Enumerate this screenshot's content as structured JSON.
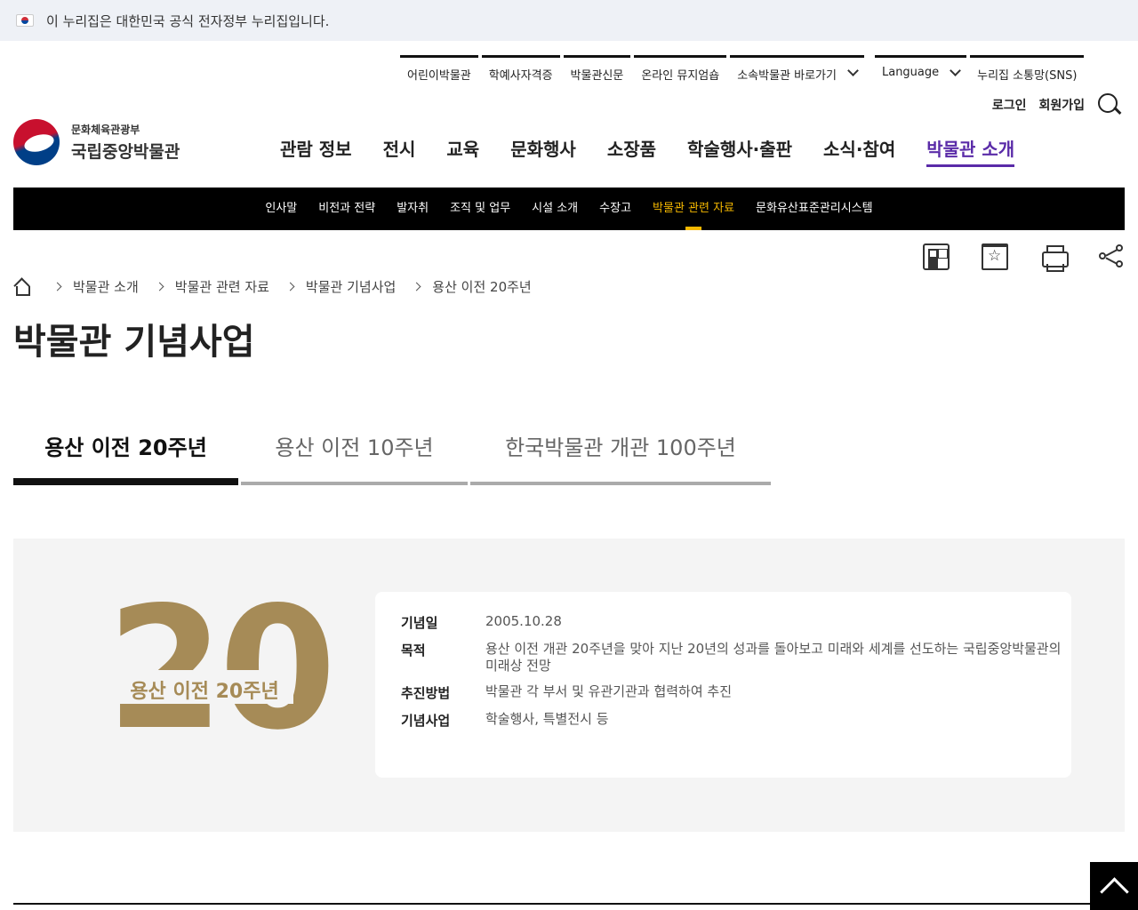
{
  "gov_banner": {
    "text": "이 누리집은 대한민국 공식 전자정부 누리집입니다."
  },
  "util_nav": [
    "어린이박물관",
    "학예사자격증",
    "박물관신문",
    "온라인 뮤지엄숍",
    "소속박물관 바로가기",
    "Language",
    "누리집 소통망(SNS)"
  ],
  "account": {
    "login": "로그인",
    "signup": "회원가입"
  },
  "logo": {
    "sub": "문화체육관광부",
    "main": "국립중앙박물관"
  },
  "main_nav": [
    "관람 정보",
    "전시",
    "교육",
    "문화행사",
    "소장품",
    "학술행사·출판",
    "소식·참여",
    "박물관 소개"
  ],
  "main_nav_active": 7,
  "sub_nav": [
    "인사말",
    "비전과 전략",
    "발자취",
    "조직 및 업무",
    "시설 소개",
    "수장고",
    "박물관 관련 자료",
    "문화유산표준관리시스템"
  ],
  "sub_nav_active": 6,
  "breadcrumb": [
    "박물관 소개",
    "박물관 관련 자료",
    "박물관 기념사업",
    "용산 이전 20주년"
  ],
  "page_title": "박물관 기념사업",
  "tabs": [
    "용산 이전 20주년",
    "용산 이전 10주년",
    "한국박물관 개관 100주년"
  ],
  "tabs_active": 0,
  "emblem": {
    "digits": "20",
    "label": "용산 이전 20주년"
  },
  "info_rows": [
    {
      "label": "기념일",
      "value": "2005.10.28"
    },
    {
      "label": "목적",
      "value": "용산 이전 개관 20주년을 맞아 지난 20년의 성과를 돌아보고 미래와 세계를 선도하는 국립중앙박물관의 미래상 전망"
    },
    {
      "label": "추진방법",
      "value": "박물관 각 부서 및 유관기관과 협력하여 추진"
    },
    {
      "label": "기념사업",
      "value": "학술행사, 특별전시 등"
    }
  ],
  "colors": {
    "accent_purple": "#5a2ba8",
    "sub_nav_active": "#f5b800",
    "emblem_gold": "#a68b57"
  }
}
